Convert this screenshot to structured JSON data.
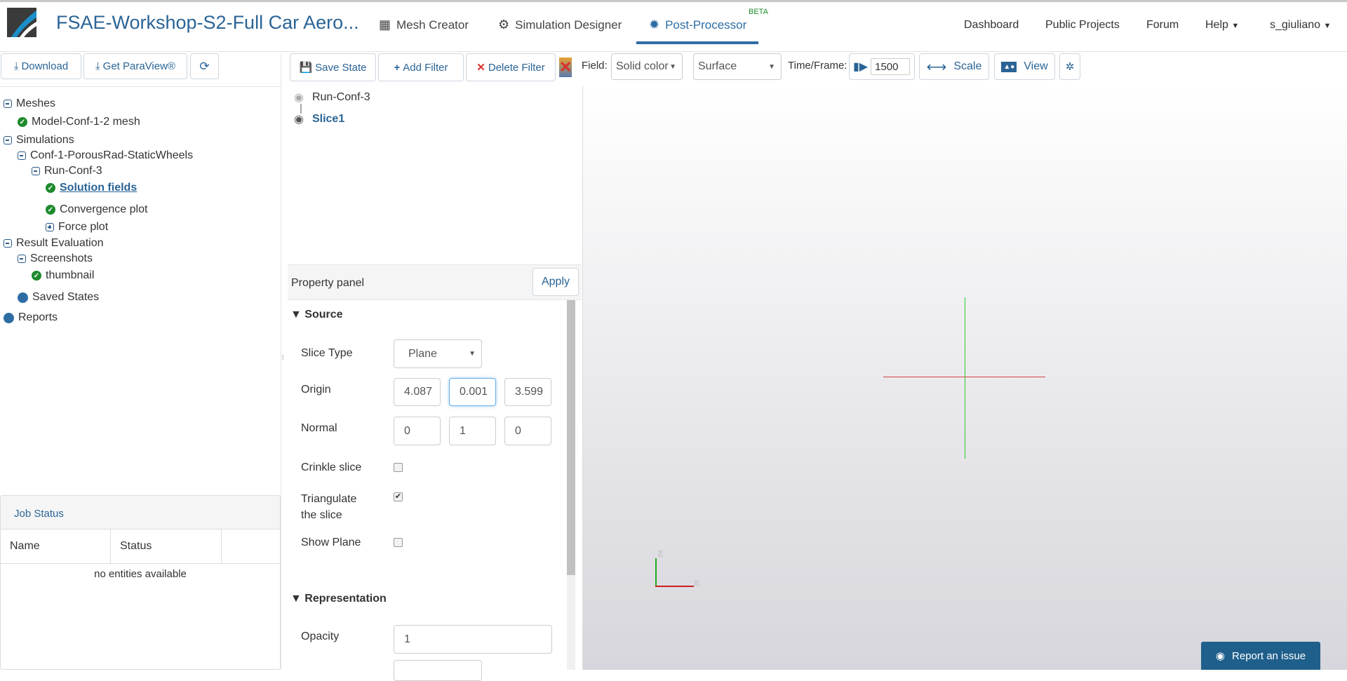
{
  "header": {
    "project_title": "FSAE-Workshop-S2-Full Car Aero...",
    "nav": [
      {
        "label": "Mesh Creator",
        "icon": "grid-icon"
      },
      {
        "label": "Simulation Designer",
        "icon": "gears-icon"
      },
      {
        "label": "Post-Processor",
        "icon": "cog-icon",
        "badge": "BETA",
        "active": true
      }
    ],
    "right_nav": [
      "Dashboard",
      "Public Projects",
      "Forum",
      "Help",
      "s_giuliano"
    ]
  },
  "left_toolbar": {
    "download": "Download",
    "get_paraview": "Get ParaView®"
  },
  "tree": {
    "meshes": "Meshes",
    "mesh1": "Model-Conf-1-2 mesh",
    "simulations": "Simulations",
    "sim1": "Conf-1-PorousRad-StaticWheels",
    "run": "Run-Conf-3",
    "solution_fields": "Solution fields",
    "convergence": "Convergence plot",
    "force": "Force plot",
    "result_eval": "Result Evaluation",
    "screenshots": "Screenshots",
    "thumbnail": "thumbnail",
    "saved_states": "Saved States",
    "reports": "Reports"
  },
  "job_status": {
    "title": "Job Status",
    "columns": [
      "Name",
      "Status"
    ],
    "empty": "no entities available"
  },
  "pv_toolbar": {
    "save_state": "Save State",
    "add_filter": "Add Filter",
    "delete_filter": "Delete Filter",
    "field_label": "Field:",
    "field_value": "Solid color",
    "representation": "Surface",
    "time_label": "Time/Frame:",
    "time_value": "1500",
    "scale": "Scale",
    "view": "View"
  },
  "pipeline": {
    "items": [
      "Run-Conf-3",
      "Slice1"
    ]
  },
  "property_panel": {
    "title": "Property panel",
    "apply": "Apply",
    "source": "Source",
    "slice_type_label": "Slice Type",
    "slice_type": "Plane",
    "origin_label": "Origin",
    "origin": [
      "4.087",
      "0.001",
      "3.599"
    ],
    "normal_label": "Normal",
    "normal": [
      "0",
      "1",
      "0"
    ],
    "crinkle_label": "Crinkle slice",
    "crinkle": false,
    "triangulate_label1": "Triangulate",
    "triangulate_label2": "the slice",
    "triangulate": true,
    "show_plane_label": "Show Plane",
    "show_plane": false,
    "representation": "Representation",
    "opacity_label": "Opacity",
    "opacity": "1"
  },
  "viewport": {
    "axis_x": "X",
    "axis_z": "Z"
  },
  "report_issue": "Report an issue",
  "colors": {
    "accent": "#2a6496",
    "nav_active": "#2e6da4",
    "check": "#1e8a2e"
  }
}
